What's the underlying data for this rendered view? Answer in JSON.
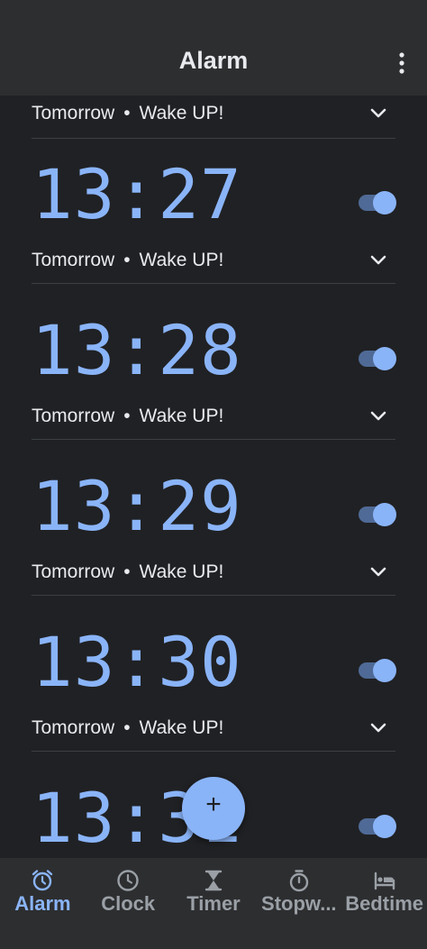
{
  "app_bar": {
    "title": "Alarm",
    "more_icon": "more-vert-icon"
  },
  "first_summary": {
    "day": "Tomorrow",
    "separator": "•",
    "label": "Wake UP!"
  },
  "alarms": [
    {
      "time": "13:27",
      "day": "Tomorrow",
      "separator": "•",
      "label": "Wake UP!",
      "enabled": true
    },
    {
      "time": "13:28",
      "day": "Tomorrow",
      "separator": "•",
      "label": "Wake UP!",
      "enabled": true
    },
    {
      "time": "13:29",
      "day": "Tomorrow",
      "separator": "•",
      "label": "Wake UP!",
      "enabled": true
    },
    {
      "time": "13:30",
      "day": "Tomorrow",
      "separator": "•",
      "label": "Wake UP!",
      "enabled": true
    },
    {
      "time": "13:31",
      "enabled": true
    }
  ],
  "fab": {
    "label": "+",
    "icon": "add-icon"
  },
  "nav": {
    "items": [
      {
        "label": "Alarm",
        "icon": "alarm-icon",
        "active": true
      },
      {
        "label": "Clock",
        "icon": "clock-icon",
        "active": false
      },
      {
        "label": "Timer",
        "icon": "hourglass-icon",
        "active": false
      },
      {
        "label": "Stopw...",
        "icon": "stopwatch-icon",
        "active": false
      },
      {
        "label": "Bedtime",
        "icon": "bed-icon",
        "active": false
      }
    ]
  },
  "colors": {
    "background": "#202124",
    "surface": "#2d2e30",
    "accent": "#8ab4f8",
    "toggle_track": "#4f6a96",
    "text": "#e8eaed",
    "inactive": "#9aa0a6"
  }
}
